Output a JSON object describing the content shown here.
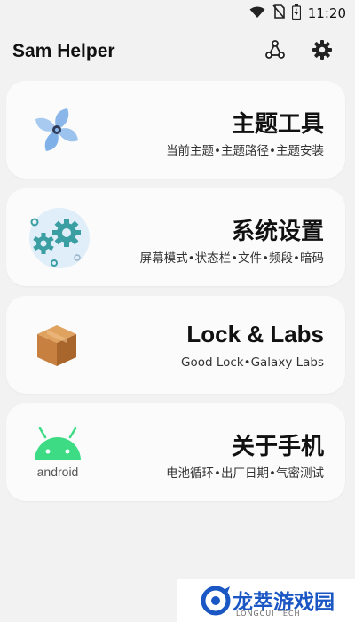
{
  "status_bar": {
    "time": "11:20",
    "icons": [
      "wifi-icon",
      "no-sim-icon",
      "battery-charging-icon"
    ]
  },
  "app_bar": {
    "title": "Sam Helper",
    "actions": [
      "share-nodes-icon",
      "gear-icon"
    ]
  },
  "cards": [
    {
      "title": "主题工具",
      "subtitle": "当前主题•主题路径•主题安装",
      "icon": "pinwheel-icon"
    },
    {
      "title": "系统设置",
      "subtitle": "屏幕模式•状态栏•文件•频段•暗码",
      "icon": "gears-icon"
    },
    {
      "title": "Lock & Labs",
      "subtitle": "Good Lock•Galaxy Labs",
      "icon": "box-icon"
    },
    {
      "title": "关于手机",
      "subtitle": "电池循环•出厂日期•气密测试",
      "icon": "android-icon"
    }
  ],
  "android_icon_text": "android",
  "watermark": {
    "text": "龙萃游戏园",
    "subtext": "LONGCUI TECH"
  },
  "colors": {
    "background": "#f2f2f2",
    "card": "#fbfbfb",
    "android_green": "#3ddc84",
    "gear_teal": "#3a9ea3",
    "watermark_blue": "#1a56c4"
  }
}
